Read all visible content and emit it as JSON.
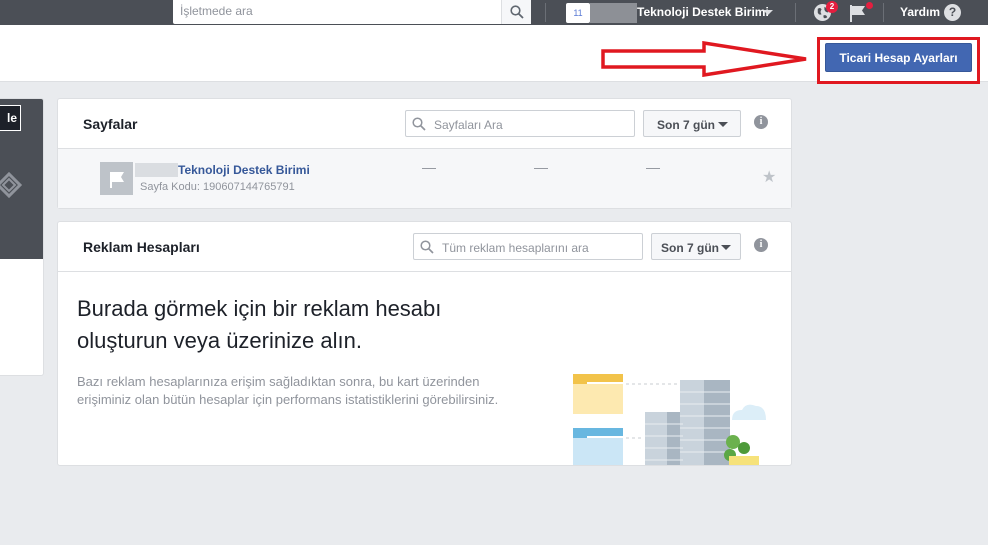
{
  "topbar": {
    "search_placeholder": "İşletmede ara",
    "business_badge": "11",
    "business_name": "Teknoloji Destek Birimi",
    "notification_count": "2",
    "help_label": "Yardım",
    "help_icon": "?"
  },
  "header": {
    "settings_button": "Ticari Hesap Ayarları"
  },
  "left_panel": {
    "button_label": "le"
  },
  "pages_card": {
    "title": "Sayfalar",
    "search_placeholder": "Sayfaları Ara",
    "range": "Son 7 gün",
    "info": "i",
    "rows": [
      {
        "name": "Teknoloji Destek Birimi",
        "code": "Sayfa Kodu: 190607144765791",
        "stat1": "—",
        "stat2": "—",
        "stat3": "—",
        "star": "★"
      }
    ]
  },
  "ads_card": {
    "title": "Reklam Hesapları",
    "search_placeholder": "Tüm reklam hesaplarını ara",
    "range": "Son 7 gün",
    "info": "i",
    "empty_title": "Burada görmek için bir reklam hesabı oluşturun veya üzerinize alın.",
    "empty_desc": "Bazı reklam hesaplarınıza erişim sağladıktan sonra, bu kart üzerinden erişiminiz olan bütün hesaplar için performans istatistiklerini görebilirsiniz."
  },
  "colors": {
    "topbar": "#4b4f56",
    "primary": "#4267b2",
    "annotation_red": "#e01820",
    "link": "#365899"
  },
  "icons": [
    "search-icon",
    "globe-icon",
    "flag-icon",
    "help-icon",
    "info-icon",
    "star-icon",
    "page-flag-icon",
    "red-arrow-annotation"
  ]
}
